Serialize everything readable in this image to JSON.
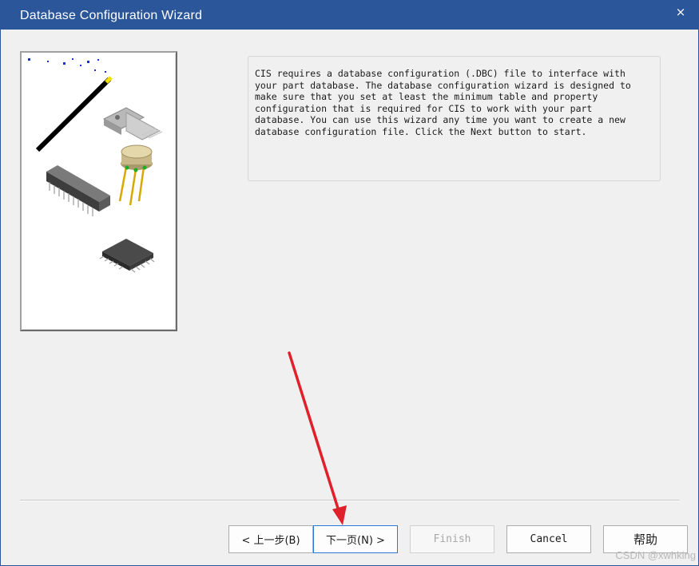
{
  "window": {
    "title": "Database Configuration Wizard",
    "close_glyph": "×"
  },
  "illustration": {
    "icons": [
      "magic-wand-icon",
      "to220-chip-icon",
      "to5-transistor-icon",
      "dip-chip-icon",
      "soic-chip-icon"
    ]
  },
  "description": {
    "text": "CIS requires a database configuration (.DBC) file to interface with\nyour part database. The database configuration wizard is designed to\nmake sure that you set at least the minimum table and property\nconfiguration that is required for CIS to work with your part\ndatabase. You can use this wizard any time you want to create a new\ndatabase configuration file. Click the Next button to start."
  },
  "buttons": {
    "back": "< 上一步(B)",
    "next": "下一页(N) >",
    "finish": "Finish",
    "cancel": "Cancel",
    "help": "帮助"
  },
  "watermark": "CSDN @xwhking",
  "colors": {
    "titlebar": "#2b579a",
    "dialog_bg": "#f0f0f0",
    "annotation_arrow": "#e0202a",
    "focus_border": "#2b79d6"
  }
}
